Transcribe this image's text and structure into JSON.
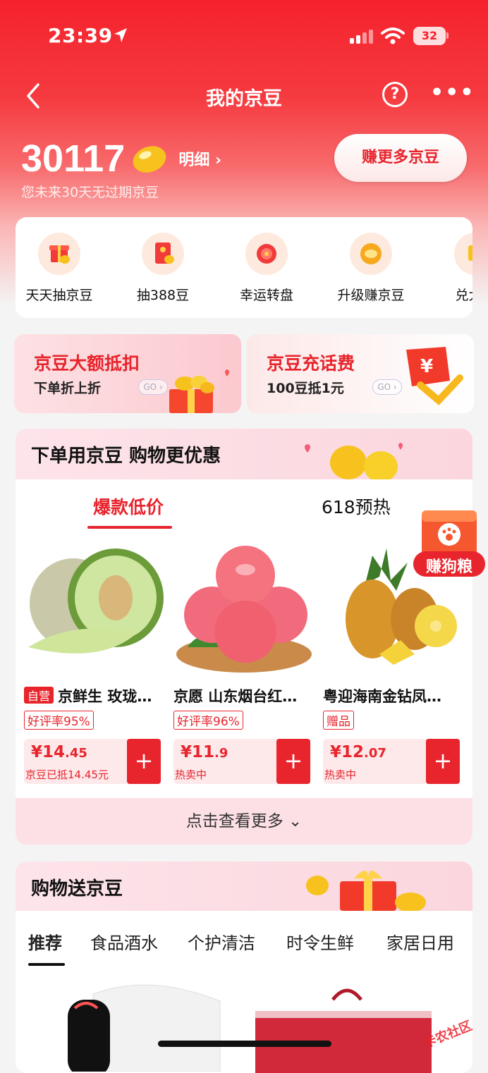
{
  "status_bar": {
    "time": "23:39",
    "battery": "32"
  },
  "nav": {
    "title": "我的京豆"
  },
  "balance": {
    "amount": "30117",
    "detail_label": "明细 ›",
    "expire_note": "您未来30天无过期京豆",
    "earn_button": "赚更多京豆"
  },
  "tasks": [
    {
      "label": "天天抽京豆",
      "icon": "gift-box-icon"
    },
    {
      "label": "抽388豆",
      "icon": "red-envelope-icon"
    },
    {
      "label": "幸运转盘",
      "icon": "spin-wheel-icon"
    },
    {
      "label": "升级赚京豆",
      "icon": "upgrade-bean-icon"
    },
    {
      "label": "兑大奢",
      "icon": "luxury-icon"
    }
  ],
  "promos": [
    {
      "title": "京豆大额抵扣",
      "subtitle": "下单折上折",
      "go": "GO ›"
    },
    {
      "title": "京豆充话费",
      "subtitle": "100豆抵1元",
      "go": "GO ›"
    }
  ],
  "shop": {
    "title": "下单用京豆 购物更优惠",
    "tabs": [
      "爆款低价",
      "618预热"
    ],
    "products": [
      {
        "self_tag": "自营",
        "name": "京鲜生 玫珑…",
        "badge": "好评率95%",
        "price_main": "¥14",
        "price_dec": ".45",
        "note": "京豆已抵14.45元"
      },
      {
        "self_tag": "",
        "name": "京愿 山东烟台红…",
        "badge": "好评率96%",
        "price_main": "¥11",
        "price_dec": ".9",
        "note": "热卖中"
      },
      {
        "self_tag": "",
        "name": "粤迎海南金钻凤…",
        "badge": "赠品",
        "price_main": "¥12",
        "price_dec": ".07",
        "note": "热卖中"
      }
    ],
    "add_symbol": "+",
    "more_label": "点击查看更多 ⌄"
  },
  "dog_badge": "赚狗粮",
  "gift": {
    "title": "购物送京豆",
    "categories": [
      "推荐",
      "食品酒水",
      "个护清洁",
      "时令生鲜",
      "家居日用"
    ]
  },
  "watermark": "卡农社区",
  "colors": {
    "brand_red": "#e8242c",
    "bean_gold": "#f5c518"
  }
}
